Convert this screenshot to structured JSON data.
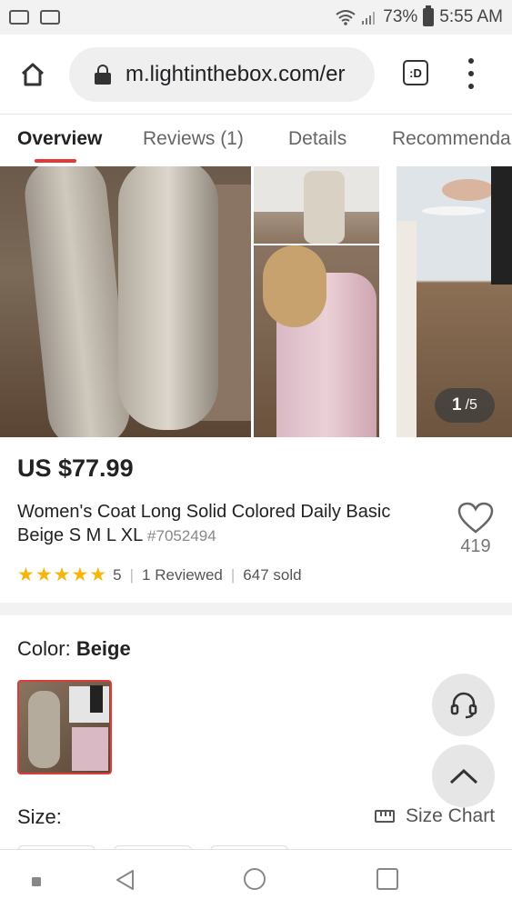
{
  "status_bar": {
    "battery": "73%",
    "time": "5:55 AM",
    "icons": [
      "voicemail-icon",
      "image-icon",
      "wifi-icon",
      "signal-icon",
      "battery-icon"
    ]
  },
  "browser": {
    "url": "m.lightinthebox.com/er",
    "tabs_label": ":D",
    "icons": [
      "home-icon",
      "lock-icon",
      "tabs-icon",
      "menu-icon"
    ]
  },
  "product_tabs": [
    {
      "label": "Overview",
      "active": true
    },
    {
      "label": "Reviews (1)",
      "active": false
    },
    {
      "label": "Details",
      "active": false
    },
    {
      "label": "Recommenda",
      "active": false
    }
  ],
  "gallery": {
    "current": "1",
    "total": "/5"
  },
  "product": {
    "price": "US $77.99",
    "title": "Women's Coat Long Solid Colored Daily Basic Beige S M L XL",
    "sku": "#7052494",
    "favorites": "419",
    "rating": "5",
    "rating_stars": 5,
    "reviewed": "1 Reviewed",
    "sold": "647 sold"
  },
  "options": {
    "color_label": "Color:",
    "color_value": "Beige",
    "size_label": "Size:",
    "size_chart": "Size Chart"
  },
  "colors": {
    "accent": "#e53935",
    "star": "#f5b50a"
  }
}
